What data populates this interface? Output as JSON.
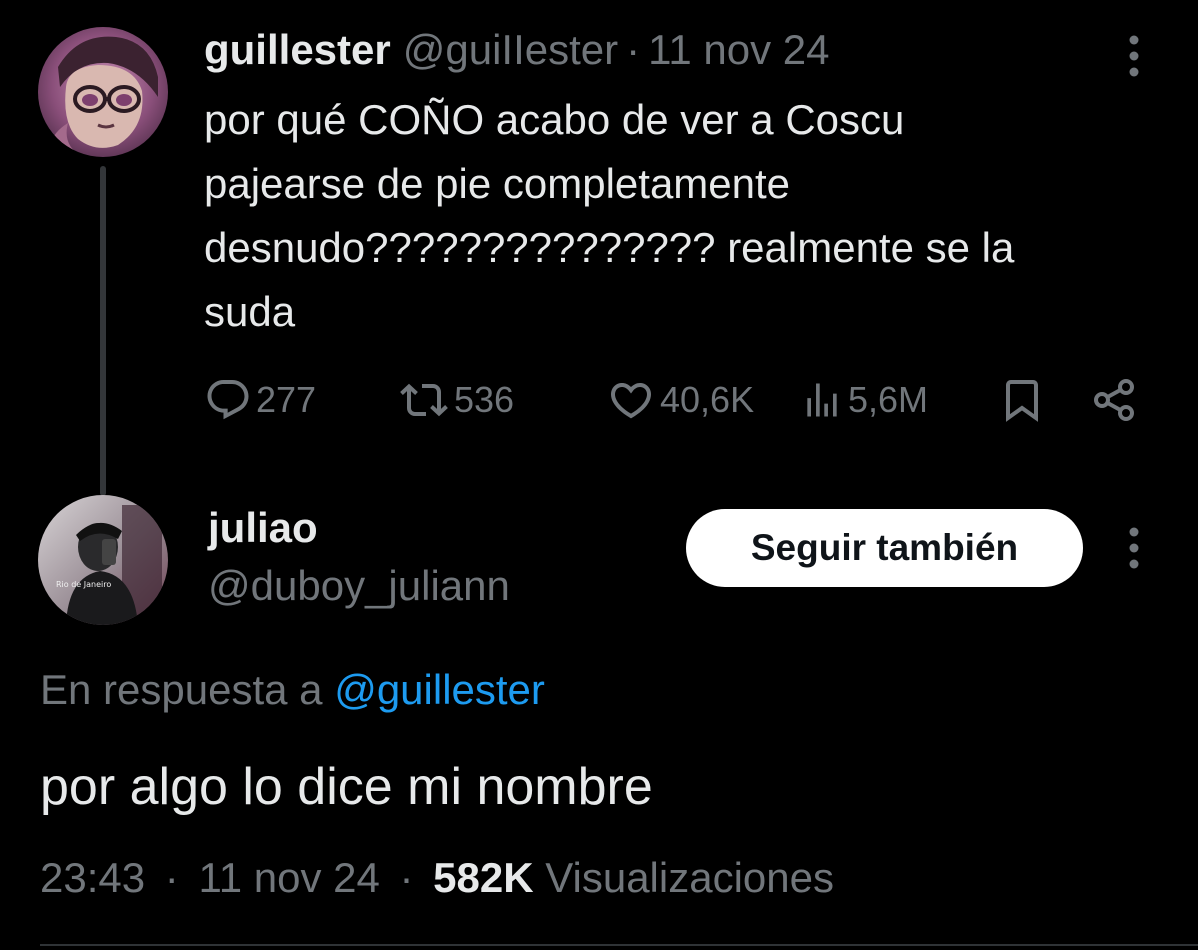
{
  "parent_tweet": {
    "display_name": "guillester",
    "handle": "@guiIIester",
    "separator": "·",
    "date": "11 nov 24",
    "text": "por qué COÑO acabo de ver a Coscu\npajearse de pie completamente\ndesnudo??????????????? realmente se la\nsuda",
    "actions": {
      "replies": "277",
      "reposts": "536",
      "likes": "40,6K",
      "views": "5,6M"
    },
    "icons": [
      "reply-icon",
      "repost-icon",
      "like-icon",
      "views-icon",
      "bookmark-icon",
      "share-icon",
      "more-icon"
    ]
  },
  "reply_tweet": {
    "display_name": "juliao",
    "handle": "@duboy_juliann",
    "follow_label": "Seguir también",
    "reply_to_prefix": "En respuesta a",
    "reply_to_mention": "@guillester",
    "text": "por algo lo dice mi nombre",
    "time": "23:43",
    "separator": "·",
    "date": "11 nov 24",
    "views_count": "582K",
    "views_label": "Visualizaciones",
    "avatar_caption": "Rio de Janeiro"
  },
  "colors": {
    "background": "#000000",
    "text": "#e7e9ea",
    "muted": "#71767b",
    "link": "#1d9bf0",
    "button_bg": "#ffffff"
  }
}
